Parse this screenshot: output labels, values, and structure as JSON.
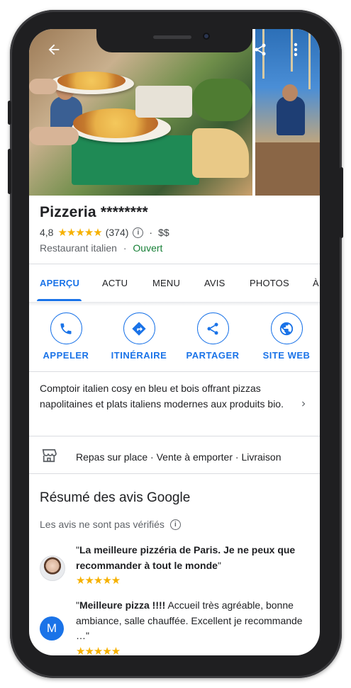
{
  "place": {
    "name": "Pizzeria ********",
    "rating": "4,8",
    "stars": "★★★★★",
    "reviews_count": "(374)",
    "price": "$$",
    "category": "Restaurant italien",
    "status": "Ouvert",
    "separator": "·"
  },
  "tabs": [
    {
      "label": "APERÇU"
    },
    {
      "label": "ACTU"
    },
    {
      "label": "MENU"
    },
    {
      "label": "AVIS"
    },
    {
      "label": "PHOTOS"
    },
    {
      "label": "À"
    }
  ],
  "actions": [
    {
      "label": "APPELER",
      "icon": "phone-icon"
    },
    {
      "label": "ITINÉRAIRE",
      "icon": "directions-icon"
    },
    {
      "label": "PARTAGER",
      "icon": "share-icon"
    },
    {
      "label": "SITE WEB",
      "icon": "globe-icon"
    }
  ],
  "description": "Comptoir italien cosy en bleu et bois offrant pizzas napolitaines et plats italiens modernes aux produits bio.",
  "services": "Repas sur place · Vente à emporter · Livraison",
  "reviews_section": {
    "title": "Résumé des avis Google",
    "note": "Les avis ne sont pas vérifiés"
  },
  "reviews": [
    {
      "quote_open": "\"",
      "bold": "La meilleure pizzéria de Paris. Je ne peux que recommander à tout le monde",
      "rest": "",
      "quote_close": "\"",
      "stars": "★★★★★"
    },
    {
      "quote_open": "\"",
      "bold": "Meilleure pizza !!!!",
      "rest": " Accueil très agréable, bonne ambiance, salle chauffée. Excellent je recommande …",
      "quote_close": "\"",
      "stars": "★★★★★",
      "avatar_letter": "M"
    }
  ],
  "colors": {
    "accent": "#1a73e8",
    "star": "#f6b100",
    "open": "#188038",
    "avatar_m": "#1a73e8"
  }
}
